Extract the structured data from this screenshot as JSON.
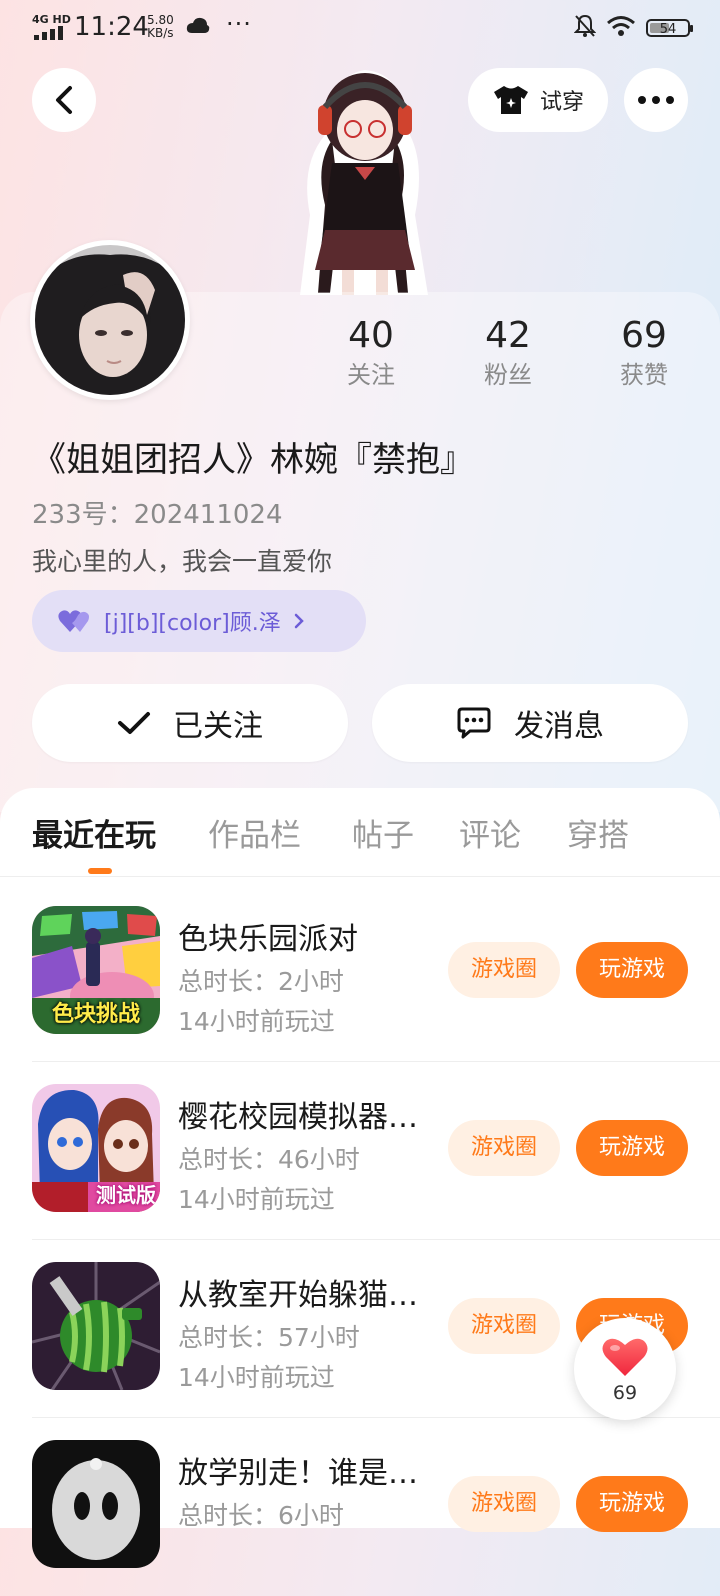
{
  "status_bar": {
    "network": "4G HD",
    "time": "11:24",
    "speed_value": "5.80",
    "speed_unit": "KB/s",
    "more": "···",
    "battery": "54",
    "battery_level": 0.54
  },
  "header": {
    "try_on_label": "试穿"
  },
  "profile": {
    "stats": [
      {
        "value": "40",
        "label": "关注"
      },
      {
        "value": "42",
        "label": "粉丝"
      },
      {
        "value": "69",
        "label": "获赞"
      }
    ],
    "nickname": "《姐姐团招人》林婉『禁抱』",
    "uid_text": "233号：202411024",
    "bio": "我心里的人，我会一直爱你",
    "cp_tag": "[j][b][color]顾.泽",
    "follow_label": "已关注",
    "message_label": "发消息"
  },
  "tabs": [
    "最近在玩",
    "作品栏",
    "帖子",
    "评论",
    "穿搭"
  ],
  "games": [
    {
      "name": "色块乐园派对",
      "duration": "总时长：2小时",
      "last_played": "14小时前玩过",
      "icon_text": "色块挑战",
      "circle_label": "游戏圈",
      "play_label": "玩游戏"
    },
    {
      "name": "樱花校园模拟器…",
      "duration": "总时长：46小时",
      "last_played": "14小时前玩过",
      "icon_text": "测试版",
      "circle_label": "游戏圈",
      "play_label": "玩游戏"
    },
    {
      "name": "从教室开始躲猫…",
      "duration": "总时长：57小时",
      "last_played": "14小时前玩过",
      "icon_text": "",
      "circle_label": "游戏圈",
      "play_label": "玩游戏"
    },
    {
      "name": "放学别走！谁是…",
      "duration": "总时长：6小时",
      "last_played": "",
      "icon_text": "",
      "circle_label": "游戏圈",
      "play_label": "玩游戏"
    }
  ],
  "float_like": {
    "count": "69"
  },
  "colors": {
    "accent": "#ff7a1a",
    "accent_light": "#fff0e3",
    "cp_purple": "#6c5cd7"
  }
}
